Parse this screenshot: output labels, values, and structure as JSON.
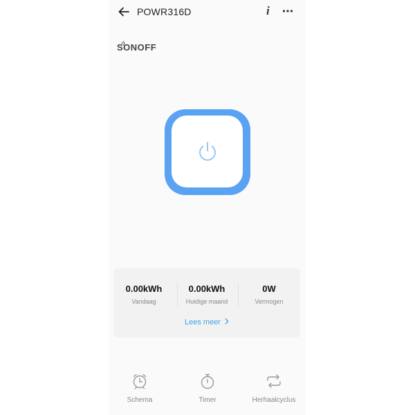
{
  "header": {
    "title": "POWR316D",
    "back_icon": "arrow-left-icon",
    "info_icon": "info-icon",
    "more_icon": "more-horizontal-icon"
  },
  "brand": {
    "logo_text": "SONOFF"
  },
  "power": {
    "icon": "power-icon",
    "accent": "#5aa2f2",
    "icon_color": "#8cc3f5"
  },
  "stats": {
    "items": [
      {
        "value": "0.00kWh",
        "label": "Vandaag"
      },
      {
        "value": "0.00kWh",
        "label": "Huidige maand"
      },
      {
        "value": "0W",
        "label": "Vermogen"
      }
    ],
    "read_more": "Lees meer",
    "read_more_icon": "chevron-right-icon",
    "link_color": "#3ea3e8"
  },
  "bottom_nav": {
    "items": [
      {
        "label": "Schema",
        "icon": "alarm-clock-icon"
      },
      {
        "label": "Timer",
        "icon": "stopwatch-icon"
      },
      {
        "label": "Herhaalcyclus",
        "icon": "repeat-icon"
      }
    ]
  }
}
